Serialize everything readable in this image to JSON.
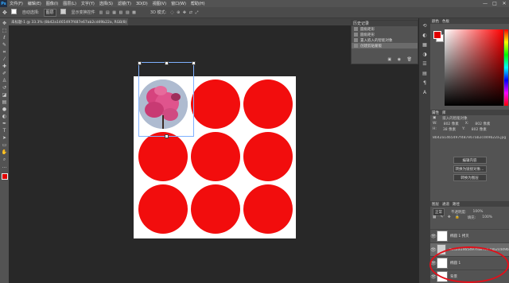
{
  "menubar": {
    "logo": "Ps",
    "items": [
      "文件(F)",
      "编辑(E)",
      "图像(I)",
      "图层(L)",
      "文字(Y)",
      "选择(S)",
      "滤镜(T)",
      "3D(D)",
      "视图(V)",
      "窗口(W)",
      "帮助(H)"
    ],
    "window_controls": [
      "—",
      "□",
      "✕"
    ]
  },
  "options": {
    "auto_select": "自动选择:",
    "target": "图层",
    "show_transform": "显示变换控件",
    "mode_3d": "3D 模式:"
  },
  "document_tab": "未标题-1 @ 33.3% (8b42a1465497f487e67ab2cd49b22a, RGB/8) *",
  "history": {
    "title": "历史记录",
    "items": [
      "圆角矩形",
      "圆角矩形",
      "置入嵌入的智能对象",
      "创建剪贴蒙版"
    ]
  },
  "color_panel": {
    "tabs": [
      "颜色",
      "色板"
    ],
    "fg_color": "#e00000",
    "bg_color": "#ffffff"
  },
  "properties": {
    "tabs": [
      "属性",
      "库"
    ],
    "type": "嵌入的智能对象",
    "w_label": "W:",
    "w_value": "802 像素",
    "x_label": "X:",
    "x_value": "802 像素",
    "h_label": "H:",
    "h_value": "38 像素",
    "y_label": "Y:",
    "y_value": "802 像素",
    "file": "8b42a1465497f487e67ab2cd49b22a.jpg",
    "buttons": [
      "编辑内容",
      "转换为链接对象...",
      "转换为图层"
    ]
  },
  "layers": {
    "tabs": [
      "图层",
      "通道",
      "路径"
    ],
    "blend_mode": "正常",
    "opacity_label": "不透明度:",
    "opacity": "100%",
    "fill_label": "填充:",
    "fill": "100%",
    "rows": [
      "椭圆 1 拷贝",
      "8b42a1465497f487e67ab2cd49b22a",
      "椭圆 1",
      "背景"
    ]
  },
  "tool_icons": [
    "move-icon",
    "marquee-icon",
    "lasso-icon",
    "quick-select-icon",
    "crop-icon",
    "eyedropper-icon",
    "healing-icon",
    "brush-icon",
    "stamp-icon",
    "history-brush-icon",
    "eraser-icon",
    "gradient-icon",
    "blur-icon",
    "dodge-icon",
    "pen-icon",
    "type-icon",
    "path-select-icon",
    "shape-icon",
    "hand-icon",
    "zoom-icon"
  ],
  "colors": {
    "circle_red": "#f20d0d",
    "annotation_red": "#e0101a"
  }
}
